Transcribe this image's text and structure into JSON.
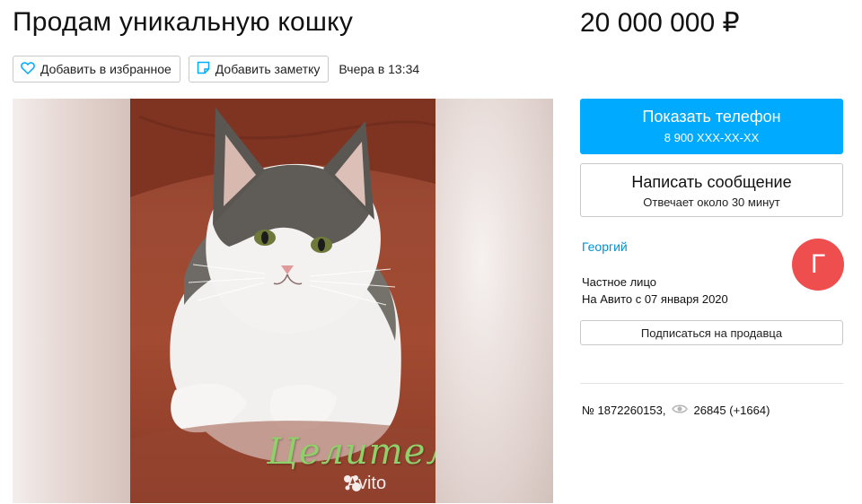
{
  "listing": {
    "title": "Продам уникальную кошку",
    "price": "20 000 000 ₽",
    "date": "Вчера в 13:34",
    "number": "№ 1872260153,",
    "views": "26845 (+1664)"
  },
  "actions": {
    "favorite_label": "Добавить в избранное",
    "note_label": "Добавить заметку"
  },
  "gallery": {
    "caption": "Целительница",
    "watermark": "Avito"
  },
  "contact": {
    "phone_label": "Показать телефон",
    "phone_number": "8 900 XXX-XX-XX",
    "message_label": "Написать сообщение",
    "message_sub": "Отвечает около 30 минут"
  },
  "seller": {
    "name": "Георгий",
    "type": "Частное лицо",
    "since": "На Авито с 07 января 2020",
    "avatar_letter": "Г",
    "subscribe_label": "Подписаться на продавца"
  },
  "icons": [
    "heart-icon",
    "note-icon",
    "eye-icon",
    "avito-logo-icon"
  ],
  "colors": {
    "accent": "#00aaff",
    "link": "#0091d9",
    "avatar": "#ee4e4e"
  }
}
